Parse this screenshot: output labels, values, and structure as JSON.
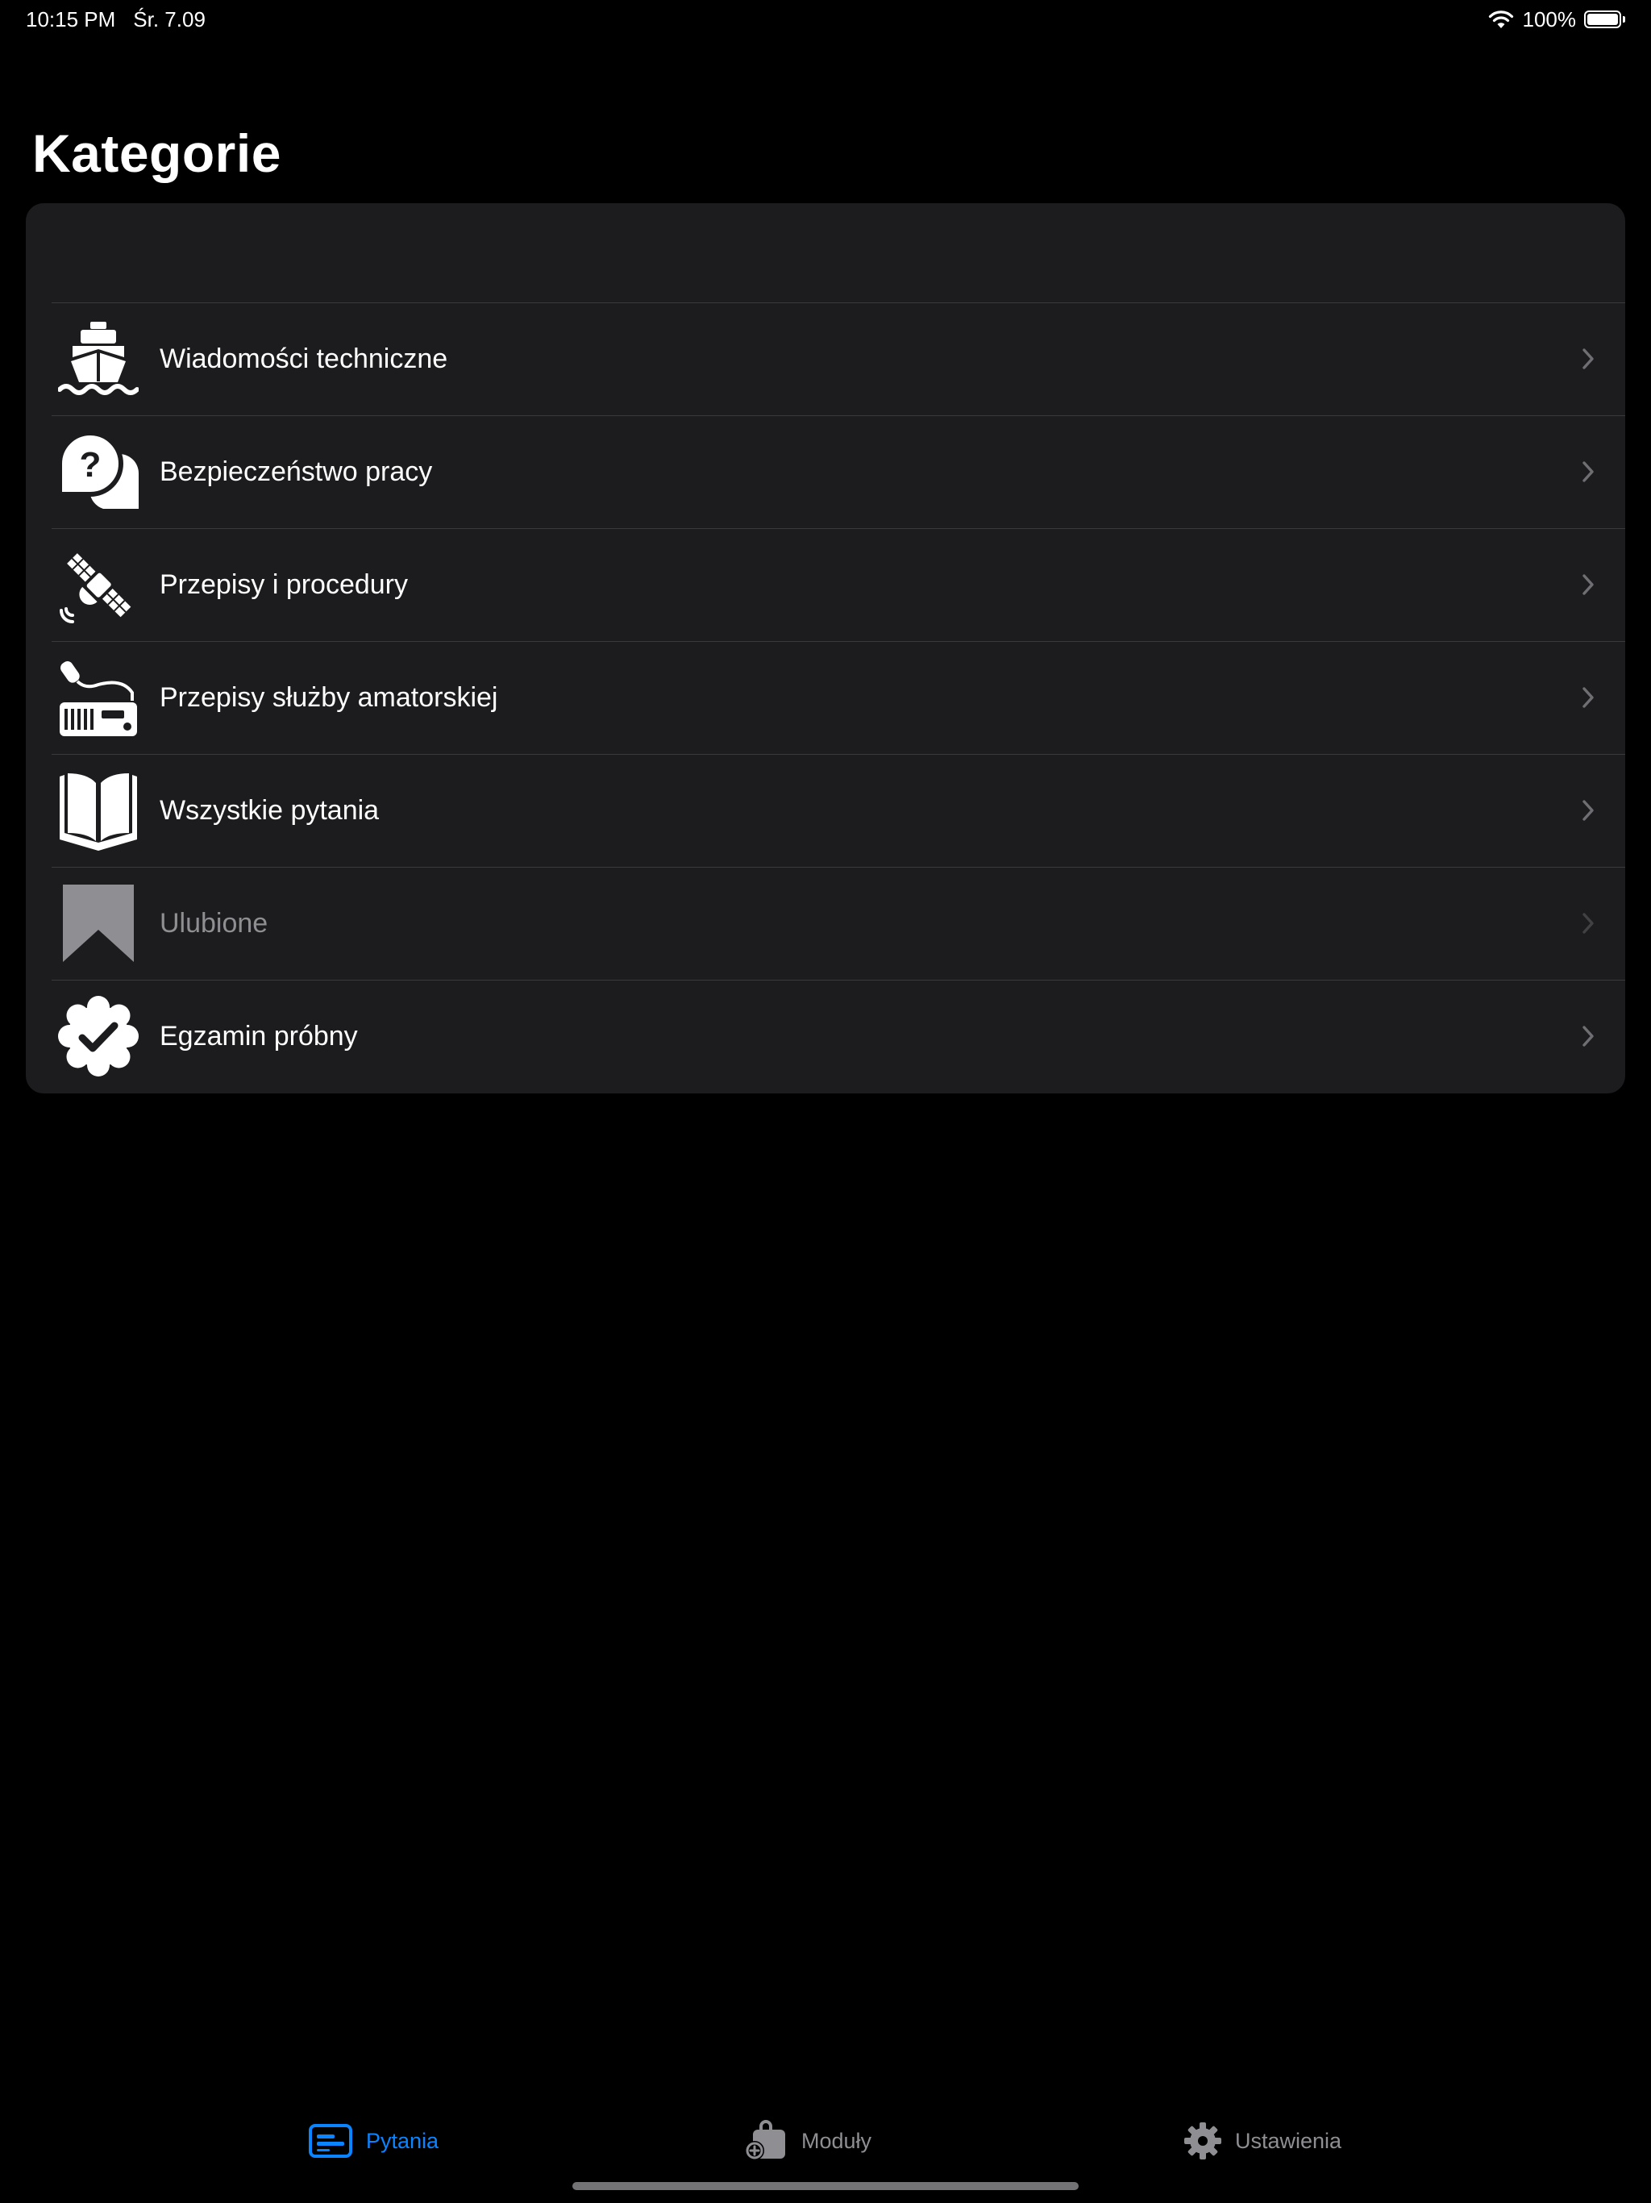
{
  "status_bar": {
    "time": "10:15 PM",
    "date": "Śr. 7.09",
    "battery_percent": "100%",
    "battery_level": 1.0,
    "wifi_icon": "wifi-icon"
  },
  "title": "Kategorie",
  "categories": [
    {
      "label": "Wiadomości techniczne",
      "icon": "ship-icon",
      "enabled": true
    },
    {
      "label": "Bezpieczeństwo pracy",
      "icon": "question-bubble-icon",
      "enabled": true
    },
    {
      "label": "Przepisy i procedury",
      "icon": "satellite-icon",
      "enabled": true
    },
    {
      "label": "Przepisy służby amatorskiej",
      "icon": "radio-transceiver-icon",
      "enabled": true
    },
    {
      "label": "Wszystkie pytania",
      "icon": "book-icon",
      "enabled": true
    },
    {
      "label": "Ulubione",
      "icon": "bookmark-icon",
      "enabled": false
    },
    {
      "label": "Egzamin próbny",
      "icon": "checkmark-seal-icon",
      "enabled": true
    }
  ],
  "tab_bar": {
    "tabs": [
      {
        "label": "Pytania",
        "icon": "questions-card-icon",
        "active": true
      },
      {
        "label": "Moduły",
        "icon": "bag-plus-icon",
        "active": false
      },
      {
        "label": "Ustawienia",
        "icon": "gear-icon",
        "active": false
      }
    ]
  },
  "colors": {
    "background": "#000000",
    "card": "#1c1c1e",
    "separator": "#3a3a3c",
    "accent": "#0a84ff",
    "inactive": "#8e8e93"
  }
}
